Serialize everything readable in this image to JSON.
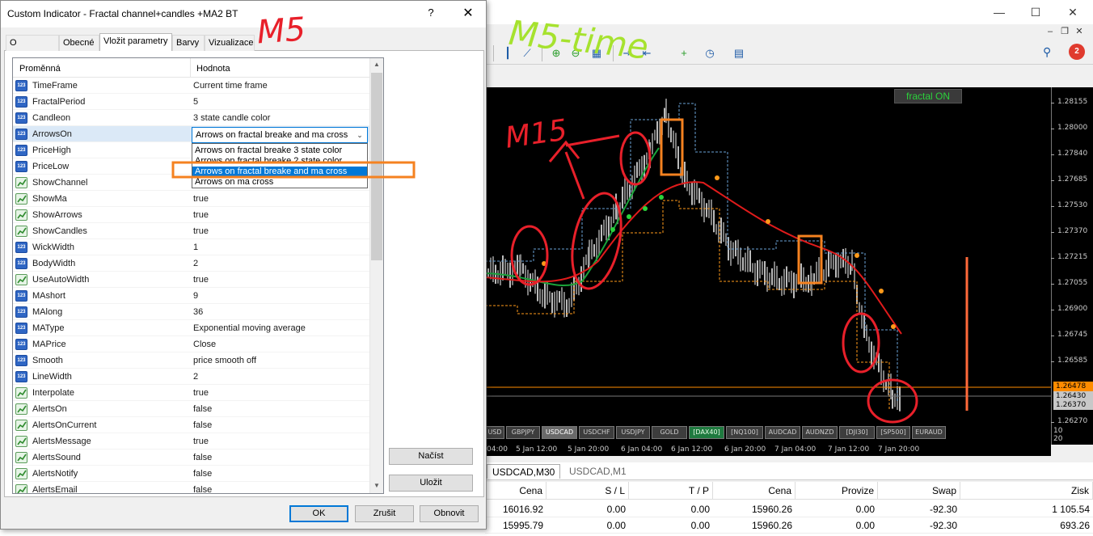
{
  "mt4": {
    "window_controls": {
      "minimize": "—",
      "maximize": "☐",
      "close": "✕"
    },
    "mdi_controls": {
      "minimize": "‒",
      "restore": "❐",
      "close": "✕"
    },
    "notifications_count": "2",
    "chart": {
      "fractal_button": "fractal ON",
      "price_labels": [
        "1.28155",
        "1.28000",
        "1.27840",
        "1.27685",
        "1.27530",
        "1.27370",
        "1.27215",
        "1.27055",
        "1.26900",
        "1.26745",
        "1.26585",
        "1.26430",
        "1.26370",
        "1.26270"
      ],
      "bid_tag": "1.26478",
      "last_tag": "1.26430",
      "ask_tag": "1.26370",
      "corner_num": "10\n20",
      "symbols": [
        "USD",
        "GBPJPY",
        "USDCAD",
        "USDCHF",
        "USDJPY",
        "GOLD",
        "[DAX40]",
        "[NQ100]",
        "AUDCAD",
        "AUDNZD",
        "[DJI30]",
        "[SP500]",
        "EURAUD"
      ],
      "time_labels": [
        "04:00",
        "5 Jan 12:00",
        "5 Jan 20:00",
        "6 Jan 04:00",
        "6 Jan 12:00",
        "6 Jan 20:00",
        "7 Jan 04:00",
        "7 Jan 12:00",
        "7 Jan 20:00"
      ],
      "colors": {
        "fast_ma": "#1aa33a",
        "slow_ma": "#e01b1b",
        "channel": "#ff9a1a",
        "upper_channel": "#6aa2d6",
        "bid_line": "#ff8c00",
        "volume_bar": "#ff6a3a"
      }
    },
    "chart_tabs": [
      "USDCAD,M30",
      "USDCAD,M1"
    ],
    "terminal": {
      "headers": [
        "Cena",
        "S / L",
        "T / P",
        "Cena",
        "Provize",
        "Swap",
        "Zisk"
      ],
      "rows": [
        [
          "16016.92",
          "0.00",
          "0.00",
          "15960.26",
          "0.00",
          "-92.30",
          "1 105.54"
        ],
        [
          "15995.79",
          "0.00",
          "0.00",
          "15960.26",
          "0.00",
          "-92.30",
          "693.26"
        ]
      ]
    }
  },
  "dialog": {
    "title": "Custom Indicator - Fractal channel+candles +MA2  BT",
    "help": "?",
    "close": "✕",
    "tabs": [
      "O programu",
      "Obecné",
      "Vložit parametry",
      "Barvy",
      "Vizualizace"
    ],
    "active_tab": "Vložit parametry",
    "grid": {
      "col_variable": "Proměnná",
      "col_value": "Hodnota",
      "rows": [
        {
          "type": "num",
          "name": "TimeFrame",
          "value": "Current time frame"
        },
        {
          "type": "num",
          "name": "FractalPeriod",
          "value": "5"
        },
        {
          "type": "num",
          "name": "Candleon",
          "value": "3 state candle color"
        },
        {
          "type": "num",
          "name": "ArrowsOn",
          "value": ""
        },
        {
          "type": "num",
          "name": "PriceHigh",
          "value": ""
        },
        {
          "type": "num",
          "name": "PriceLow",
          "value": ""
        },
        {
          "type": "bool",
          "name": "ShowChannel",
          "value": ""
        },
        {
          "type": "bool",
          "name": "ShowMa",
          "value": "true"
        },
        {
          "type": "bool",
          "name": "ShowArrows",
          "value": "true"
        },
        {
          "type": "bool",
          "name": "ShowCandles",
          "value": "true"
        },
        {
          "type": "num",
          "name": "WickWidth",
          "value": "1"
        },
        {
          "type": "num",
          "name": "BodyWidth",
          "value": "2"
        },
        {
          "type": "bool",
          "name": "UseAutoWidth",
          "value": "true"
        },
        {
          "type": "num",
          "name": "MAshort",
          "value": "9"
        },
        {
          "type": "num",
          "name": "MAlong",
          "value": "36"
        },
        {
          "type": "num",
          "name": "MAType",
          "value": "Exponential moving average"
        },
        {
          "type": "num",
          "name": "MAPrice",
          "value": "Close"
        },
        {
          "type": "num",
          "name": "Smooth",
          "value": "price smooth off"
        },
        {
          "type": "num",
          "name": "LineWidth",
          "value": "2"
        },
        {
          "type": "bool",
          "name": "Interpolate",
          "value": "true"
        },
        {
          "type": "bool",
          "name": "AlertsOn",
          "value": "false"
        },
        {
          "type": "bool",
          "name": "AlertsOnCurrent",
          "value": "false"
        },
        {
          "type": "bool",
          "name": "AlertsMessage",
          "value": "true"
        },
        {
          "type": "bool",
          "name": "AlertsSound",
          "value": "false"
        },
        {
          "type": "bool",
          "name": "AlertsNotify",
          "value": "false"
        },
        {
          "type": "bool",
          "name": "AlertsEmail",
          "value": "false"
        }
      ]
    },
    "combo": {
      "value": "Arrows on fractal breake and ma cross",
      "options": [
        "Arrows on fractal breake 3 state color",
        "Arrows on fractal breake 2 state color",
        "Arrows on fractal breake and ma cross",
        "Arrows on  ma cross"
      ],
      "highlighted_index": 2
    },
    "buttons": {
      "load": "Načíst",
      "save": "Uložit",
      "ok": "OK",
      "reset": "Zrušit",
      "default": "Obnovit"
    }
  },
  "annotations": {
    "text_1": "M5",
    "text_2": "M5-time",
    "text_3": "M15"
  }
}
